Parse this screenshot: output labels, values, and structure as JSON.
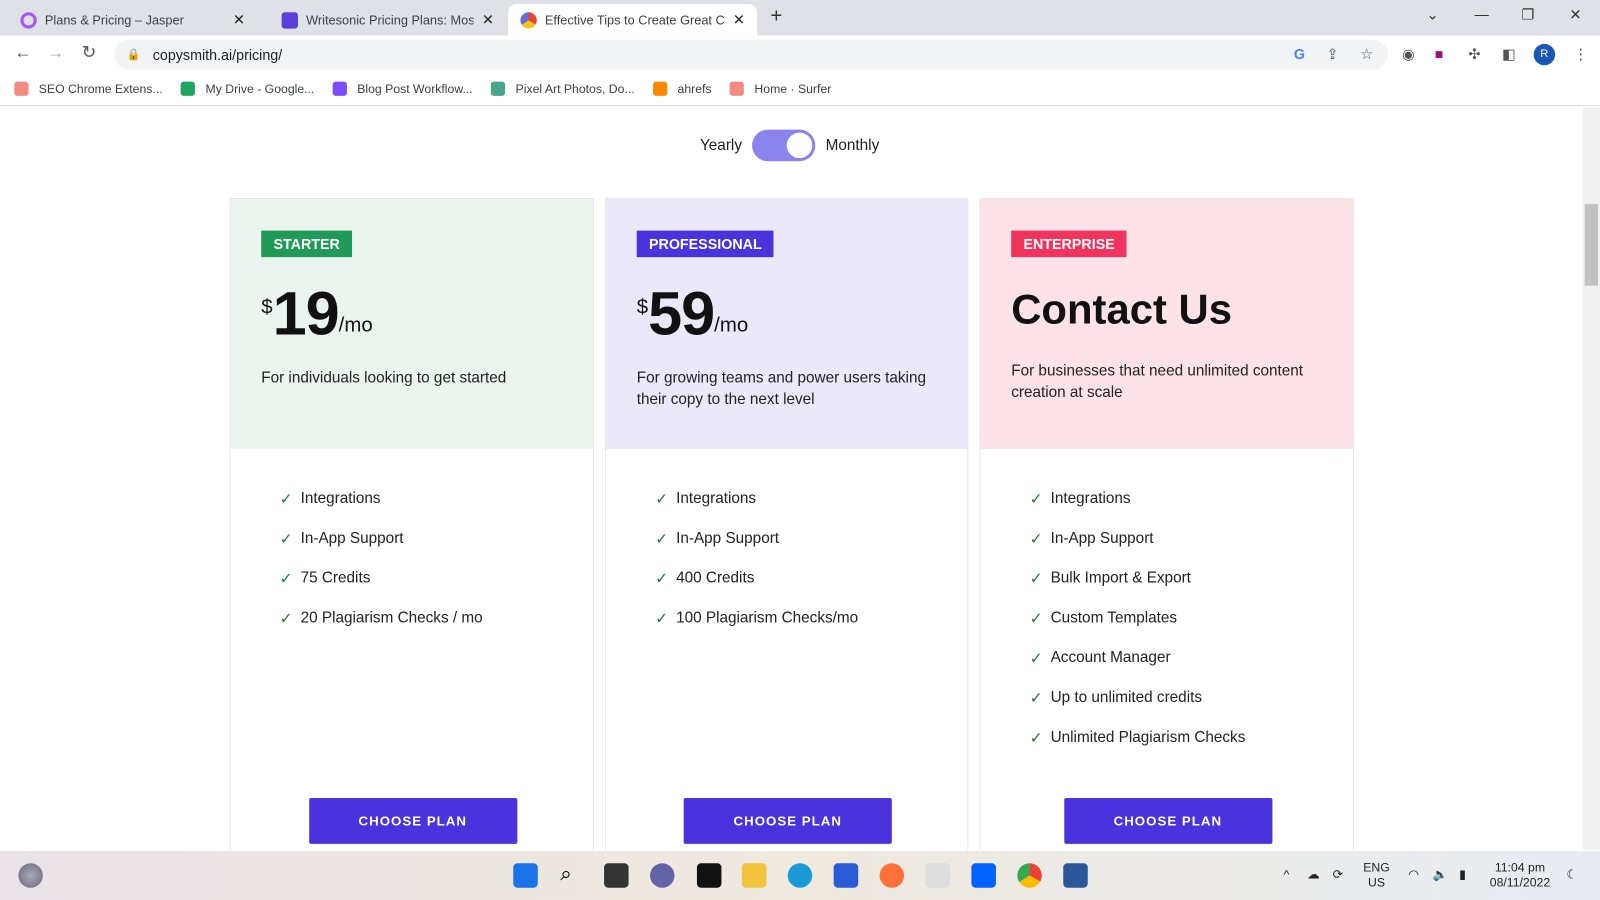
{
  "browser": {
    "tabs": [
      {
        "title": "Plans & Pricing – Jasper",
        "color": "#a855f7"
      },
      {
        "title": "Writesonic Pricing Plans: Most Af",
        "color": "#5b3fd9"
      },
      {
        "title": "Effective Tips to Create Great Co",
        "color": "#e94335"
      }
    ],
    "new_tab": "+",
    "url": "copysmith.ai/pricing/",
    "profile_initial": "R",
    "bookmarks": [
      {
        "label": "SEO Chrome Extens...",
        "color": "#f28b82"
      },
      {
        "label": "My Drive - Google...",
        "color": "#1fa463"
      },
      {
        "label": "Blog Post Workflow...",
        "color": "#7c4dff"
      },
      {
        "label": "Pixel Art Photos, Do...",
        "color": "#4aa58f"
      },
      {
        "label": "ahrefs",
        "color": "#ff8800"
      },
      {
        "label": "Home · Surfer",
        "color": "#f28b82"
      }
    ]
  },
  "billing": {
    "yearly": "Yearly",
    "monthly": "Monthly",
    "selected": "Monthly"
  },
  "plans": [
    {
      "badge": "STARTER",
      "badge_color": "#1f9b57",
      "bg": "#ebf4ef",
      "currency": "$",
      "price": "19",
      "period": "/mo",
      "desc": "For individuals looking to get started",
      "features": [
        "Integrations",
        "In-App Support",
        "75 Credits",
        "20 Plagiarism Checks / mo"
      ],
      "button": "CHOOSE PLAN"
    },
    {
      "badge": "PROFESSIONAL",
      "badge_color": "#4a32dc",
      "bg": "#ebe8fa",
      "currency": "$",
      "price": "59",
      "period": "/mo",
      "desc": "For growing teams and power users taking their copy to the next level",
      "features": [
        "Integrations",
        "In-App Support",
        "400 Credits",
        "100 Plagiarism Checks/mo"
      ],
      "button": "CHOOSE PLAN"
    },
    {
      "badge": "ENTERPRISE",
      "badge_color": "#f0345d",
      "bg": "#fde3e8",
      "title": "Contact Us",
      "desc": "For businesses that need unlimited content creation at scale",
      "features": [
        "Integrations",
        "In-App Support",
        "Bulk Import & Export",
        "Custom Templates",
        "Account Manager",
        "Up to unlimited credits",
        "Unlimited Plagiarism Checks"
      ],
      "button": "CHOOSE PLAN"
    }
  ],
  "taskbar": {
    "lang": "ENG",
    "region": "US",
    "time": "11:04 pm",
    "date": "08/11/2022"
  }
}
